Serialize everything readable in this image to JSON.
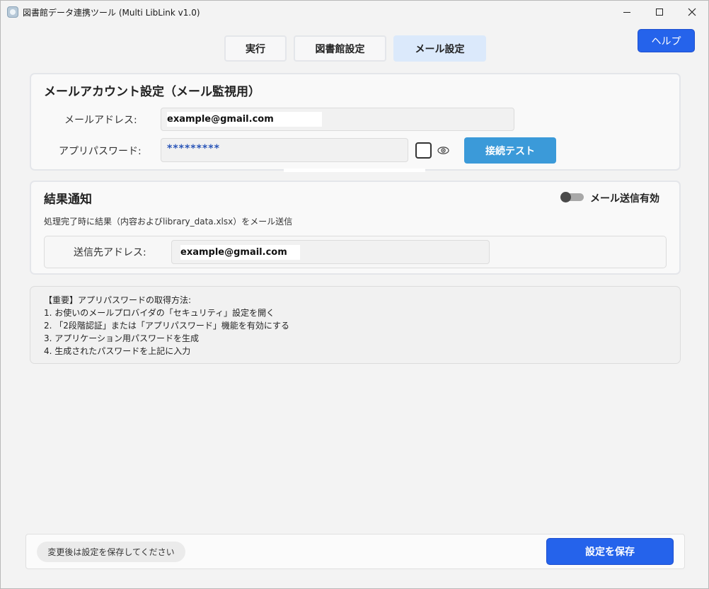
{
  "window": {
    "title": "図書館データ連携ツール (Multi LibLink v1.0)"
  },
  "tabs": [
    {
      "label": "実行"
    },
    {
      "label": "図書館設定"
    },
    {
      "label": "メール設定"
    }
  ],
  "help_button": "ヘルプ",
  "account": {
    "title": "メールアカウント設定（メール監視用）",
    "email_label": "メールアドレス:",
    "email_value": "example@gmail.com",
    "password_label": "アプリパスワード:",
    "password_value": "*********",
    "test_button": "接続テスト"
  },
  "notify": {
    "title": "結果通知",
    "toggle_label": "メール送信有効",
    "toggle_on": false,
    "description": "処理完了時に結果（内容およびlibrary_data.xlsx）をメール送信",
    "recipient_label": "送信先アドレス:",
    "recipient_value": "example@gmail.com"
  },
  "info": {
    "lines": [
      "【重要】アプリパスワードの取得方法:",
      "1. お使いのメールプロバイダの「セキュリティ」設定を開く",
      "2. 「2段階認証」または「アプリパスワード」機能を有効にする",
      "3. アプリケーション用パスワードを生成",
      "4. 生成されたパスワードを上記に入力"
    ]
  },
  "footer": {
    "hint": "変更後は設定を保存してください",
    "save_button": "設定を保存"
  },
  "colors": {
    "accent": "#2563eb",
    "test_button": "#3b9ad9",
    "active_tab": "#dbe9fb"
  },
  "icons": [
    "app-icon",
    "minimize-icon",
    "maximize-icon",
    "close-icon",
    "eye-icon"
  ]
}
